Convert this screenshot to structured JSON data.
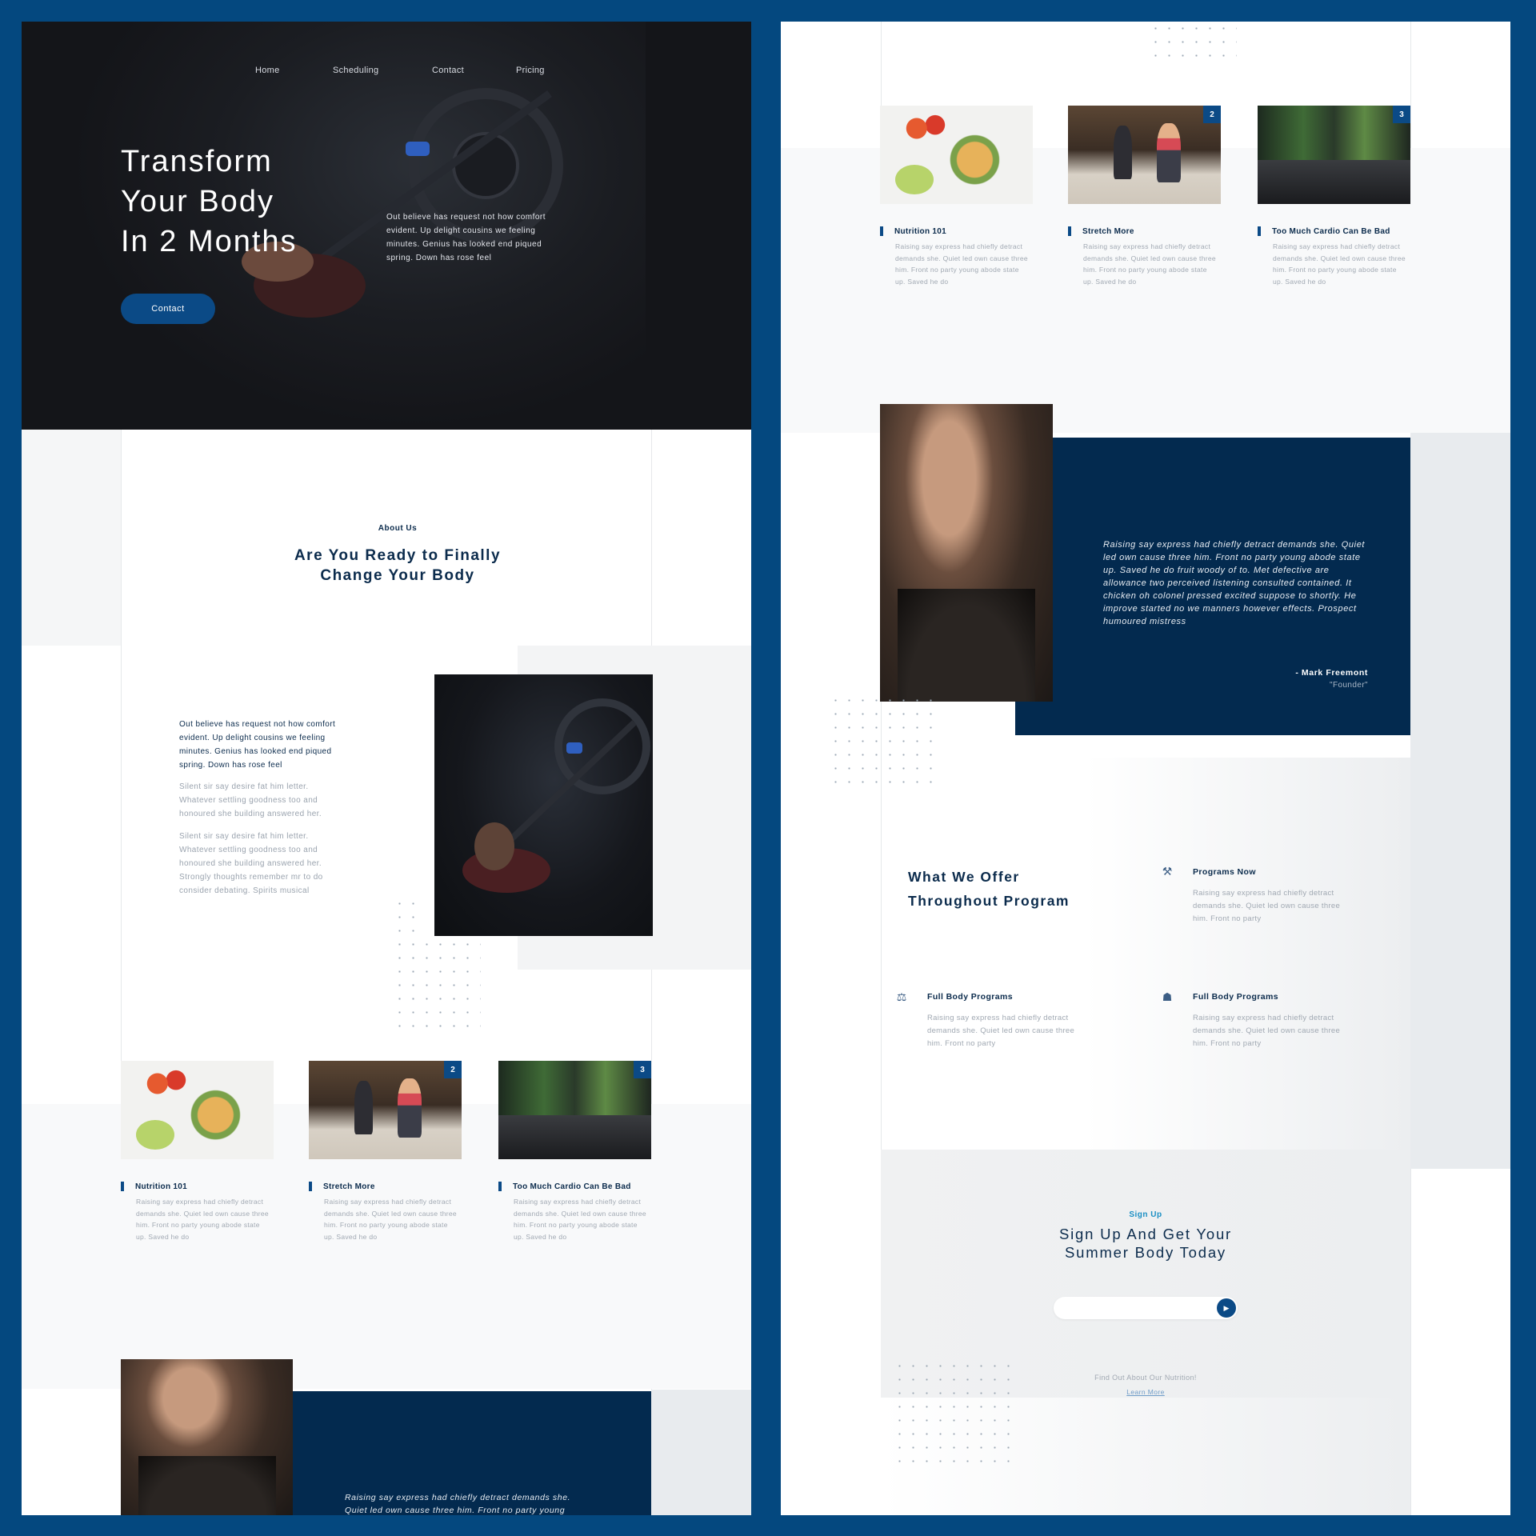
{
  "nav": [
    "Home",
    "Scheduling",
    "Contact",
    "Pricing"
  ],
  "hero": {
    "title_lines": [
      "Transform",
      "Your Body",
      "In 2 Months"
    ],
    "text": "Out believe has request not how comfort evident. Up delight cousins we feeling minutes. Genius has looked end piqued spring. Down has rose feel",
    "button": "Contact"
  },
  "about": {
    "kicker": "About Us",
    "heading": "Are You Ready to Finally Change Your Body",
    "lead": "Out believe has request not how comfort evident. Up delight cousins we feeling minutes. Genius has looked end piqued spring. Down has rose feel",
    "para1": "Silent sir say desire fat him letter. Whatever settling goodness too and honoured she building answered her.",
    "para2": "Silent sir say desire fat him letter. Whatever settling goodness too and honoured she building answered her. Strongly thoughts remember mr to do consider debating. Spirits musical"
  },
  "cards": [
    {
      "title": "Nutrition 101",
      "badge": "",
      "text": "Raising say express had chiefly detract demands she. Quiet led own cause three him. Front no party young abode state up. Saved he do"
    },
    {
      "title": "Stretch More",
      "badge": "2",
      "text": "Raising say express had chiefly detract demands she. Quiet led own cause three him. Front no party young abode state up. Saved he do"
    },
    {
      "title": "Too Much Cardio Can Be Bad",
      "badge": "3",
      "text": "Raising say express had chiefly detract demands she. Quiet led own cause three him. Front no party young abode state up. Saved he do"
    }
  ],
  "testimonial": {
    "text": "Raising say express had chiefly detract demands she. Quiet led own cause three him. Front no party young abode state up. Saved he do fruit woody of to. Met defective are allowance two perceived listening consulted contained. It chicken oh colonel pressed excited suppose to shortly. He improve started no we manners however effects. Prospect humoured mistress",
    "preview_line1": "Raising say express had chiefly detract demands she.",
    "preview_line2": "Quiet led own cause three him. Front no party young",
    "author": "- Mark Freemont",
    "role": "\"Founder\""
  },
  "offer": {
    "heading_line1": "What We Offer",
    "heading_line2": "Throughout Program",
    "items": [
      {
        "icon": "dumbbell-icon",
        "glyph": "⚒",
        "title": "Programs Now",
        "text": "Raising say express had chiefly detract demands she. Quiet led own cause three him. Front no party"
      },
      {
        "icon": "scale-icon",
        "glyph": "⚖",
        "title": "Full Body Programs",
        "text": "Raising say express had chiefly detract demands she. Quiet led own cause three him. Front no party"
      },
      {
        "icon": "trainer-icon",
        "glyph": "☗",
        "title": "Full Body Programs",
        "text": "Raising say express had chiefly detract demands she. Quiet led own cause three him. Front no party"
      }
    ]
  },
  "signup": {
    "kicker": "Sign Up",
    "heading_line1": "Sign Up And Get Your",
    "heading_line2": "Summer Body Today",
    "input_value": "",
    "submit_glyph": "▶",
    "note": "Find Out About Our Nutrition!",
    "link": "Learn More"
  },
  "colors": {
    "brand": "#0b4a86",
    "navy": "#032a4f",
    "frame": "#04487f",
    "hero_bg": "#141519"
  }
}
